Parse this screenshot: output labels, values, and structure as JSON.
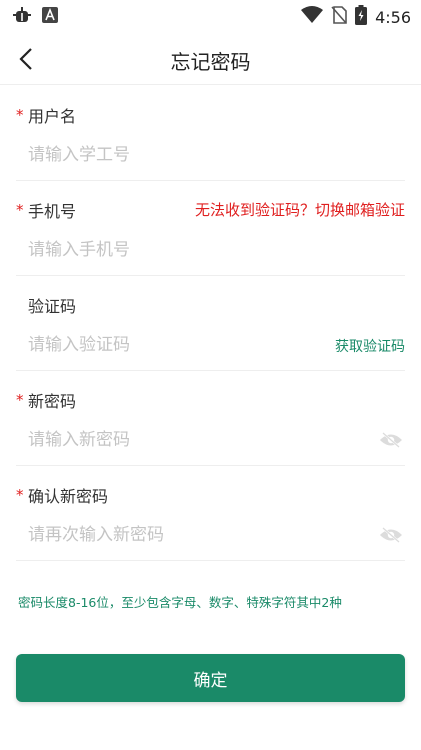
{
  "status_bar": {
    "time": "4:56",
    "left_icons": [
      "bug-icon",
      "a-box-icon"
    ],
    "right_icons": [
      "wifi-icon",
      "no-sim-icon",
      "battery-icon"
    ]
  },
  "header": {
    "back_icon": "chevron-left-icon",
    "title": "忘记密码"
  },
  "form": {
    "username": {
      "required": "*",
      "label": "用户名",
      "placeholder": "请输入学工号"
    },
    "phone": {
      "required": "*",
      "label": "手机号",
      "placeholder": "请输入手机号",
      "alt_link": "无法收到验证码？切换邮箱验证"
    },
    "code": {
      "label": "验证码",
      "placeholder": "请输入验证码",
      "action": "获取验证码"
    },
    "new_password": {
      "required": "*",
      "label": "新密码",
      "placeholder": "请输入新密码",
      "toggle_icon": "eye-off-icon"
    },
    "confirm_password": {
      "required": "*",
      "label": "确认新密码",
      "placeholder": "请再次输入新密码",
      "toggle_icon": "eye-off-icon"
    }
  },
  "hint": "密码长度8-16位，至少包含字母、数字、特殊字符其中2种",
  "submit_label": "确定",
  "colors": {
    "accent": "#1a8a68",
    "required": "#e02020",
    "placeholder": "#c4c4c4",
    "divider": "#eeeeee"
  }
}
